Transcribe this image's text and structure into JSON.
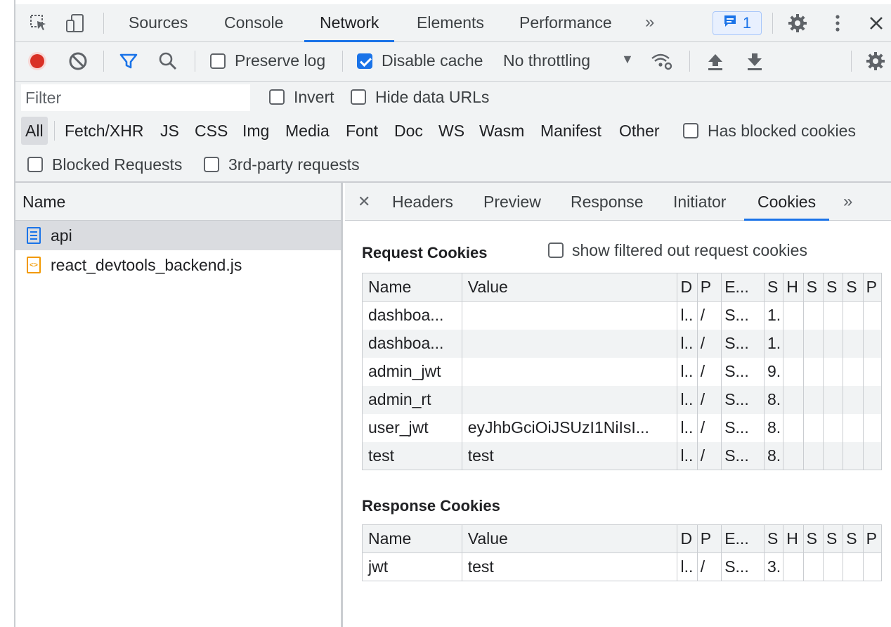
{
  "top_tabs": [
    "Sources",
    "Console",
    "Network",
    "Elements",
    "Performance"
  ],
  "active_top_tab": "Network",
  "issues_count": "1",
  "toolbar": {
    "preserve_log": "Preserve log",
    "disable_cache": "Disable cache",
    "throttling": "No throttling"
  },
  "filter": {
    "placeholder": "Filter",
    "invert": "Invert",
    "hide_data_urls": "Hide data URLs",
    "types": [
      "All",
      "Fetch/XHR",
      "JS",
      "CSS",
      "Img",
      "Media",
      "Font",
      "Doc",
      "WS",
      "Wasm",
      "Manifest",
      "Other"
    ],
    "has_blocked_cookies": "Has blocked cookies",
    "blocked_requests": "Blocked Requests",
    "third_party": "3rd-party requests"
  },
  "requests": {
    "header": "Name",
    "items": [
      "api",
      "react_devtools_backend.js"
    ]
  },
  "detail_tabs": [
    "Headers",
    "Preview",
    "Response",
    "Initiator",
    "Cookies"
  ],
  "active_detail_tab": "Cookies",
  "request_cookies": {
    "title": "Request Cookies",
    "show_filtered": "show filtered out request cookies",
    "columns": [
      "Name",
      "Value",
      "D",
      "P",
      "E...",
      "S",
      "H",
      "S",
      "S",
      "S",
      "P"
    ],
    "rows": [
      [
        "dashboa...",
        "",
        "l..",
        "/",
        "S...",
        "1.",
        "",
        "",
        "",
        "",
        ""
      ],
      [
        "dashboa...",
        "",
        "l..",
        "/",
        "S...",
        "1.",
        "",
        "",
        "",
        "",
        ""
      ],
      [
        "admin_jwt",
        "",
        "l..",
        "/",
        "S...",
        "9.",
        "",
        "",
        "",
        "",
        ""
      ],
      [
        "admin_rt",
        "",
        "l..",
        "/",
        "S...",
        "8.",
        "",
        "",
        "",
        "",
        ""
      ],
      [
        "user_jwt",
        "eyJhbGciOiJSUzI1NiIsI...",
        "l..",
        "/",
        "S...",
        "8.",
        "",
        "",
        "",
        "",
        ""
      ],
      [
        "test",
        "test",
        "l..",
        "/",
        "S...",
        "8.",
        "",
        "",
        "",
        "",
        ""
      ]
    ]
  },
  "response_cookies": {
    "title": "Response Cookies",
    "columns": [
      "Name",
      "Value",
      "D",
      "P",
      "E...",
      "S",
      "H",
      "S",
      "S",
      "S",
      "P"
    ],
    "rows": [
      [
        "jwt",
        "test",
        "l..",
        "/",
        "S...",
        "3.",
        "",
        "",
        "",
        "",
        ""
      ]
    ]
  }
}
